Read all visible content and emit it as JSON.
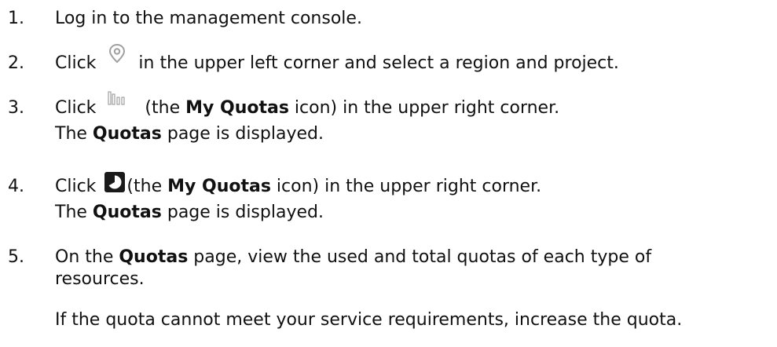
{
  "steps": [
    {
      "number": "1.",
      "text": "Log in to the management console."
    },
    {
      "number": "2.",
      "before_icon": "Click",
      "icon": "location-pin-icon",
      "after_icon": "in the upper left corner and select a region and project."
    },
    {
      "number": "3.",
      "before_icon": "Click",
      "icon": "bar-chart-quotas-icon",
      "after_icon_1": "(the ",
      "bold": "My Quotas",
      "after_icon_2": " icon) in the upper right corner.",
      "sub_bold": "Quotas",
      "sub_rest": " page is displayed.",
      "sub_pre": "The "
    },
    {
      "number": "4.",
      "before_icon": "Click",
      "icon": "pie-quotas-icon",
      "after_icon_1": "(the ",
      "bold": "My Quotas",
      "after_icon_2": " icon) in the upper right corner.",
      "sub_pre": "The ",
      "sub_bold": "Quotas",
      "sub_rest": " page is displayed."
    },
    {
      "number": "5.",
      "pre": "On the ",
      "bold": "Quotas",
      "rest": " page, view the used and total quotas of each type of resources.",
      "sub": "If the quota cannot meet your service requirements, increase the quota."
    }
  ],
  "colors": {
    "text": "#111111",
    "icon_gray": "#a0a0a0",
    "icon_dark": "#1a1a1a"
  }
}
